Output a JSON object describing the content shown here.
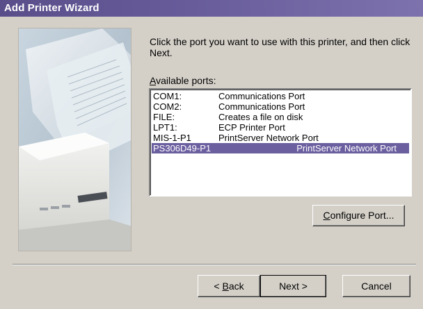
{
  "window": {
    "title": "Add Printer Wizard"
  },
  "instruction": "Click the port you want to use with this printer, and then click Next.",
  "ports_label": {
    "accel": "A",
    "rest": "vailable ports:"
  },
  "ports": [
    {
      "port": "COM1:",
      "description": "Communications Port",
      "selected": false
    },
    {
      "port": "COM2:",
      "description": "Communications Port",
      "selected": false
    },
    {
      "port": "FILE:",
      "description": "Creates a file on disk",
      "selected": false
    },
    {
      "port": "LPT1:",
      "description": "ECP Printer Port",
      "selected": false
    },
    {
      "port": "MIS-1-P1",
      "description": "PrintServer Network Port",
      "selected": false
    },
    {
      "port": "PS306D49-P1",
      "description": "PrintServer Network Port",
      "selected": true
    }
  ],
  "buttons": {
    "configure": {
      "accel": "C",
      "rest": "onfigure Port..."
    },
    "back": {
      "prefix": "< ",
      "accel": "B",
      "rest": "ack"
    },
    "next": "Next >",
    "cancel": "Cancel"
  },
  "colors": {
    "title_bar": "#5a4e8a",
    "selection": "#6b5fa0",
    "dialog_bg": "#d4d0c8"
  },
  "icons": {
    "side_image": "printer-illustration"
  }
}
